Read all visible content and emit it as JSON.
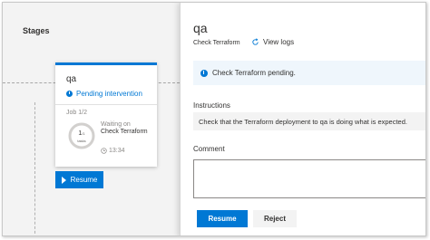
{
  "stages": {
    "title": "Stages",
    "card": {
      "name": "qa",
      "status": "Pending intervention",
      "job": "Job 1/2",
      "ring_count": "1",
      "ring_total": "/1",
      "ring_sub": "tasks",
      "waiting_label": "Waiting on",
      "task_name": "Check Terraform",
      "time": "13:34"
    },
    "resume_label": "Resume"
  },
  "panel": {
    "title": "qa",
    "subtitle": "Check Terraform",
    "view_logs": "View logs",
    "message": "Check Terraform pending.",
    "instructions_label": "Instructions",
    "instructions_text": "Check that the Terraform deployment to qa is doing what is expected.",
    "comment_label": "Comment",
    "comment_value": "",
    "resume_label": "Resume",
    "reject_label": "Reject"
  },
  "colors": {
    "accent": "#0078d4",
    "info_bg": "#eff6fc",
    "stage_bg": "#f3f3f3"
  },
  "icons": [
    "pending-icon",
    "refresh-icon",
    "info-icon",
    "play-icon",
    "clock-icon"
  ]
}
